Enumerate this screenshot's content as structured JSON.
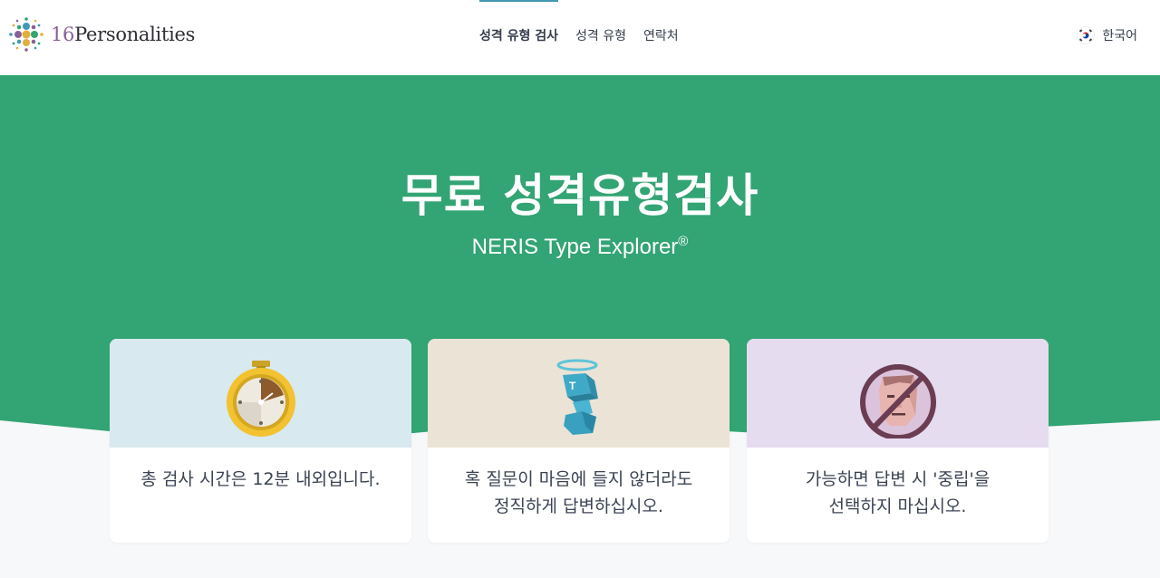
{
  "header": {
    "logo": {
      "number": "16",
      "word": "Personalities"
    },
    "nav": [
      {
        "label": "성격 유형 검사",
        "active": true
      },
      {
        "label": "성격 유형",
        "active": false
      },
      {
        "label": "연락처",
        "active": false
      }
    ],
    "language": {
      "label": "한국어",
      "flag_icon": "south-korea-flag-icon"
    }
  },
  "hero": {
    "title": "무료 성격유형검사",
    "subtitle": "NERIS Type Explorer",
    "subtitle_mark": "®"
  },
  "cards": [
    {
      "icon": "stopwatch-icon",
      "bg": "#d8e9ef",
      "lines": [
        "총 검사 시간은 12분 내외입니다."
      ]
    },
    {
      "icon": "honest-block-figure-icon",
      "bg": "#ebe4d6",
      "lines": [
        "혹 질문이 마음에 들지 않더라도",
        "정직하게 답변하십시오."
      ]
    },
    {
      "icon": "no-neutral-face-icon",
      "bg": "#e6dcf0",
      "lines": [
        "가능하면 답변 시 '중립'을",
        "선택하지 마십시오."
      ]
    }
  ],
  "colors": {
    "brand_green": "#33a474",
    "active_underline": "#4298b4",
    "logo_purple": "#88619a"
  }
}
